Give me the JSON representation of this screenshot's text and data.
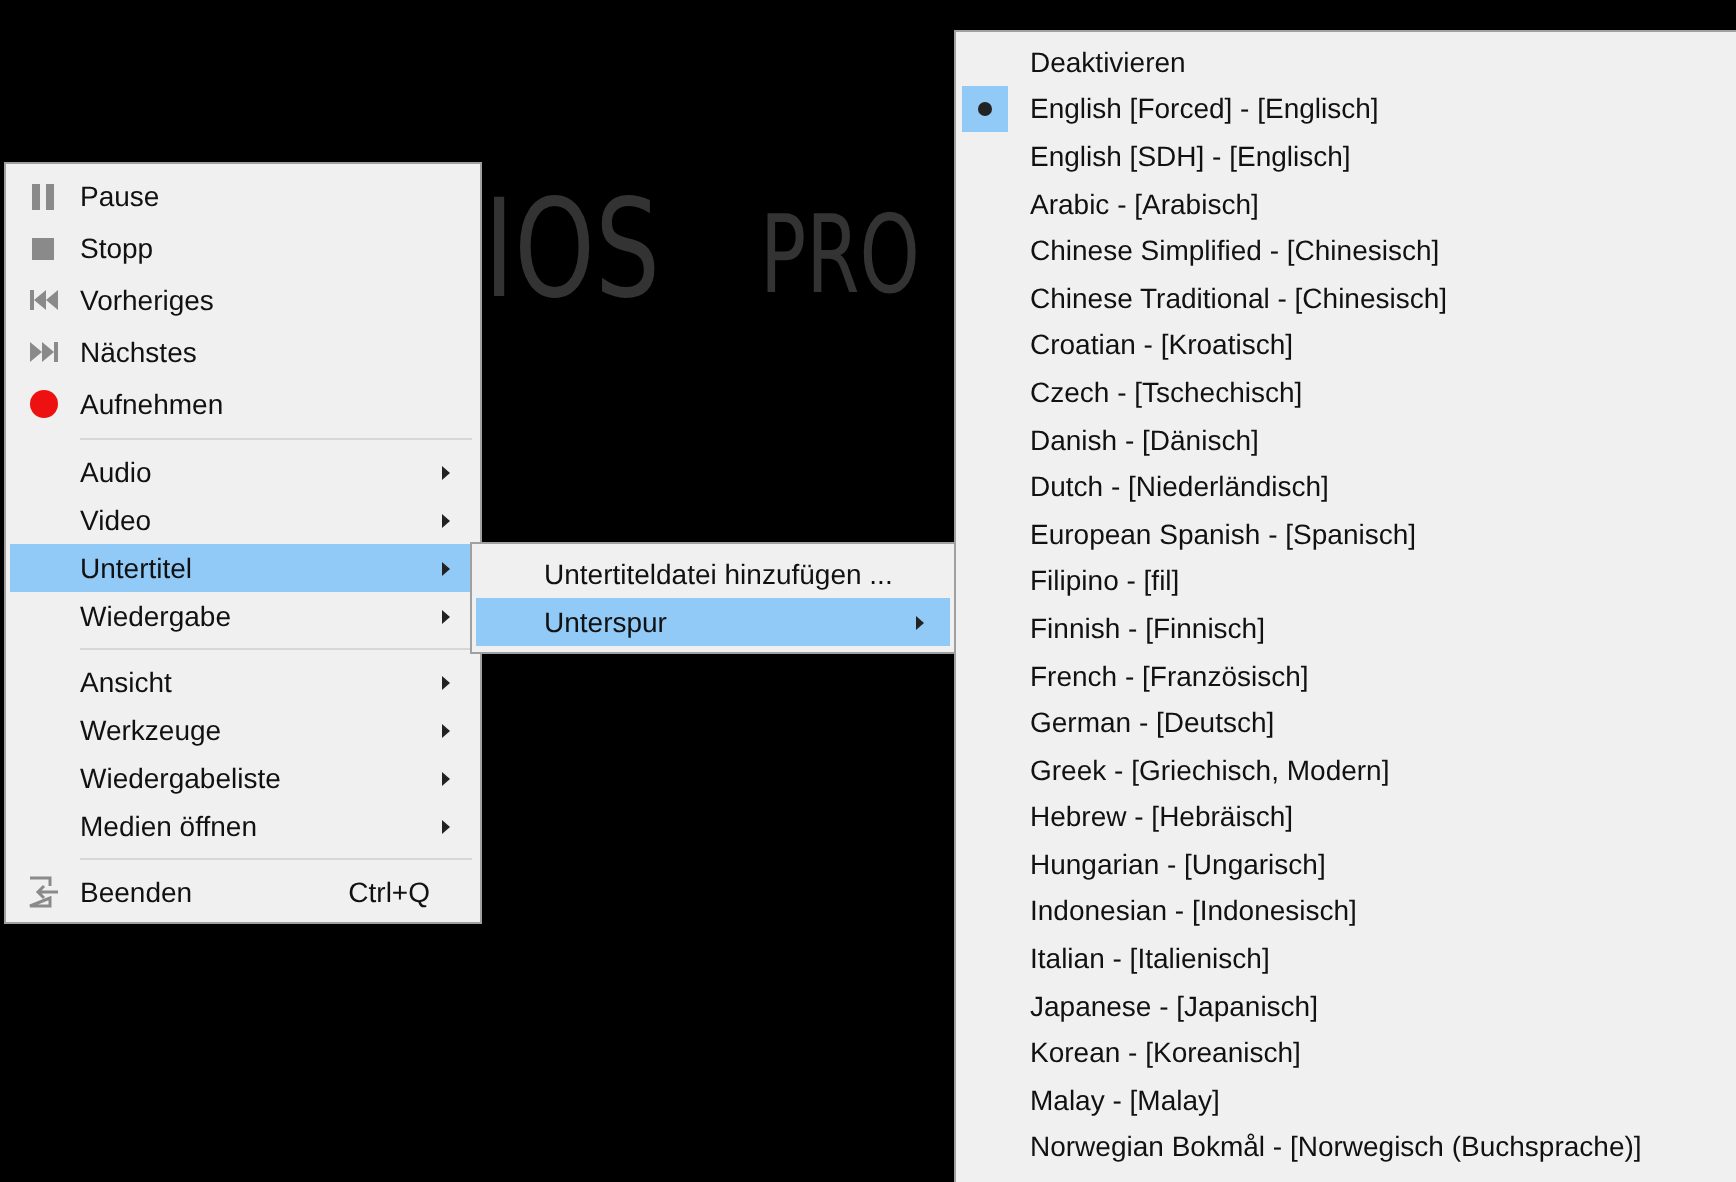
{
  "logo": {
    "text_1": "IOS",
    "text_2": "PRO"
  },
  "context_menu": {
    "groups": [
      [
        {
          "label": "Pause",
          "kind": "pause",
          "submenu": false,
          "selected": false
        },
        {
          "label": "Stopp",
          "kind": "stop",
          "submenu": false,
          "selected": false
        },
        {
          "label": "Vorheriges",
          "kind": "previous",
          "submenu": false,
          "selected": false
        },
        {
          "label": "Nächstes",
          "kind": "next",
          "submenu": false,
          "selected": false
        },
        {
          "label": "Aufnehmen",
          "kind": "record",
          "submenu": false,
          "selected": false
        }
      ],
      [
        {
          "label": "Audio",
          "kind": "plain",
          "submenu": true,
          "selected": false
        },
        {
          "label": "Video",
          "kind": "plain",
          "submenu": true,
          "selected": false
        },
        {
          "label": "Untertitel",
          "kind": "plain",
          "submenu": true,
          "selected": true
        },
        {
          "label": "Wiedergabe",
          "kind": "plain",
          "submenu": true,
          "selected": false
        }
      ],
      [
        {
          "label": "Ansicht",
          "kind": "plain",
          "submenu": true,
          "selected": false
        },
        {
          "label": "Werkzeuge",
          "kind": "plain",
          "submenu": true,
          "selected": false
        },
        {
          "label": "Wiedergabeliste",
          "kind": "plain",
          "submenu": true,
          "selected": false
        },
        {
          "label": "Medien öffnen",
          "kind": "plain",
          "submenu": true,
          "selected": false
        }
      ],
      [
        {
          "label": "Beenden",
          "kind": "exit",
          "submenu": false,
          "selected": false,
          "shortcut": "Ctrl+Q"
        }
      ]
    ]
  },
  "subtitle_menu": {
    "items": [
      {
        "label": "Untertiteldatei hinzufügen ...",
        "submenu": false,
        "selected": false
      },
      {
        "label": "Unterspur",
        "submenu": true,
        "selected": true
      }
    ]
  },
  "track_menu": {
    "items": [
      {
        "label": "Deaktivieren",
        "selected": false
      },
      {
        "label": "English [Forced] - [Englisch]",
        "selected": true
      },
      {
        "label": "English [SDH] - [Englisch]",
        "selected": false
      },
      {
        "label": "Arabic - [Arabisch]",
        "selected": false
      },
      {
        "label": "Chinese Simplified - [Chinesisch]",
        "selected": false
      },
      {
        "label": "Chinese Traditional - [Chinesisch]",
        "selected": false
      },
      {
        "label": "Croatian - [Kroatisch]",
        "selected": false
      },
      {
        "label": "Czech - [Tschechisch]",
        "selected": false
      },
      {
        "label": "Danish - [Dänisch]",
        "selected": false
      },
      {
        "label": "Dutch - [Niederländisch]",
        "selected": false
      },
      {
        "label": "European Spanish - [Spanisch]",
        "selected": false
      },
      {
        "label": "Filipino - [fil]",
        "selected": false
      },
      {
        "label": "Finnish - [Finnisch]",
        "selected": false
      },
      {
        "label": "French - [Französisch]",
        "selected": false
      },
      {
        "label": "German - [Deutsch]",
        "selected": false
      },
      {
        "label": "Greek - [Griechisch, Modern]",
        "selected": false
      },
      {
        "label": "Hebrew - [Hebräisch]",
        "selected": false
      },
      {
        "label": "Hungarian - [Ungarisch]",
        "selected": false
      },
      {
        "label": "Indonesian - [Indonesisch]",
        "selected": false
      },
      {
        "label": "Italian - [Italienisch]",
        "selected": false
      },
      {
        "label": "Japanese - [Japanisch]",
        "selected": false
      },
      {
        "label": "Korean - [Koreanisch]",
        "selected": false
      },
      {
        "label": "Malay - [Malay]",
        "selected": false
      },
      {
        "label": "Norwegian Bokmål - [Norwegisch (Buchsprache)]",
        "selected": false
      }
    ]
  }
}
